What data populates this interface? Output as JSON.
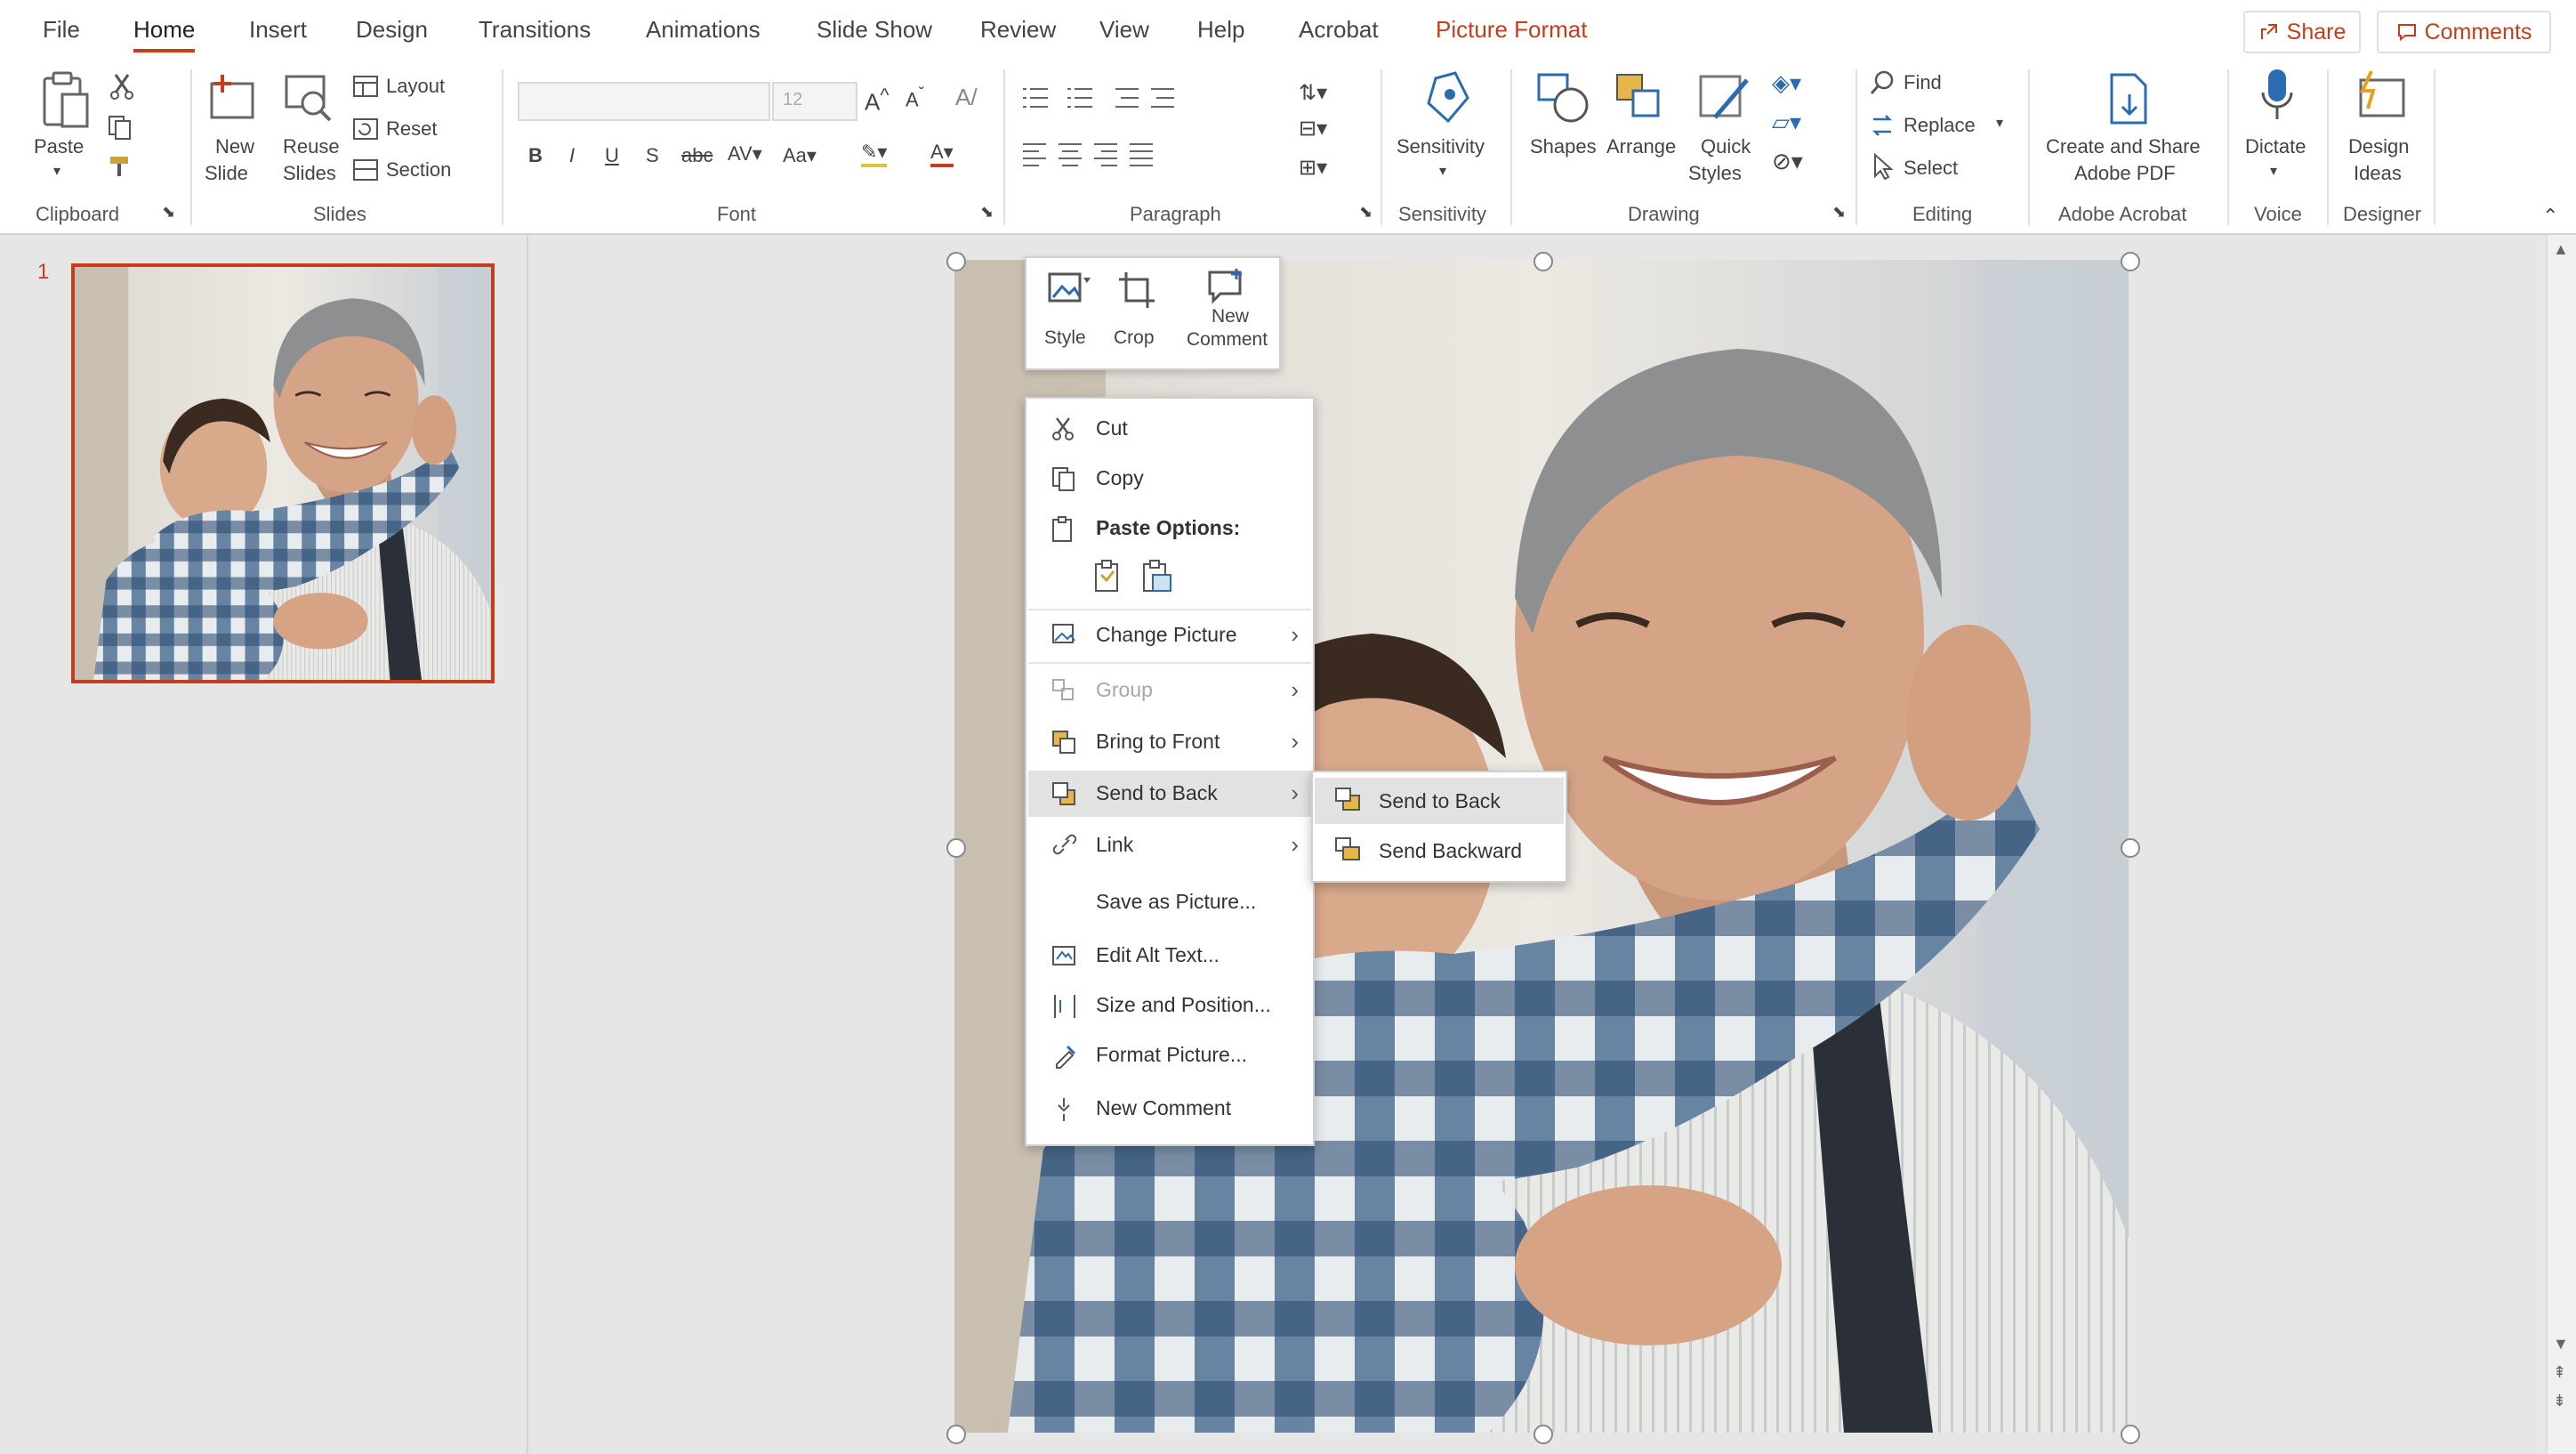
{
  "menu": {
    "tabs": [
      "File",
      "Home",
      "Insert",
      "Design",
      "Transitions",
      "Animations",
      "Slide Show",
      "Review",
      "View",
      "Help",
      "Acrobat"
    ],
    "active": "Home",
    "context_tab": "Picture Format",
    "share_label": "Share",
    "comments_label": "Comments"
  },
  "ribbon": {
    "clipboard": {
      "group": "Clipboard",
      "paste": "Paste"
    },
    "slides": {
      "group": "Slides",
      "new_slide_1": "New",
      "new_slide_2": "Slide",
      "reuse_1": "Reuse",
      "reuse_2": "Slides",
      "layout": "Layout",
      "reset": "Reset",
      "section": "Section"
    },
    "font": {
      "group": "Font",
      "size": "12"
    },
    "paragraph": {
      "group": "Paragraph"
    },
    "sensitivity": {
      "group": "Sensitivity",
      "button": "Sensitivity"
    },
    "drawing": {
      "group": "Drawing",
      "shapes": "Shapes",
      "arrange": "Arrange",
      "quick_styles_1": "Quick",
      "quick_styles_2": "Styles"
    },
    "editing": {
      "group": "Editing",
      "find": "Find",
      "replace": "Replace",
      "select": "Select"
    },
    "acrobat": {
      "group": "Adobe Acrobat",
      "line1": "Create and Share",
      "line2": "Adobe PDF"
    },
    "voice": {
      "group": "Voice",
      "dictate": "Dictate"
    },
    "designer": {
      "group": "Designer",
      "line1": "Design",
      "line2": "Ideas"
    }
  },
  "thumbnails": {
    "slide_number": "1"
  },
  "mini_toolbar": {
    "style": "Style",
    "crop": "Crop",
    "new_comment_1": "New",
    "new_comment_2": "Comment"
  },
  "context_menu": {
    "cut": "Cut",
    "copy": "Copy",
    "paste_options": "Paste Options:",
    "change_picture": "Change Picture",
    "group": "Group",
    "bring_to_front": "Bring to Front",
    "send_to_back": "Send to Back",
    "link": "Link",
    "save_as_picture": "Save as Picture...",
    "edit_alt_text": "Edit Alt Text...",
    "size_and_position": "Size and Position...",
    "format_picture": "Format Picture...",
    "new_comment": "New Comment"
  },
  "submenu": {
    "send_to_back": "Send to Back",
    "send_backward": "Send Backward"
  },
  "colors": {
    "accent": "#c43e1c",
    "ribbon_bg": "#ffffff",
    "workspace": "#e6e6e6"
  }
}
